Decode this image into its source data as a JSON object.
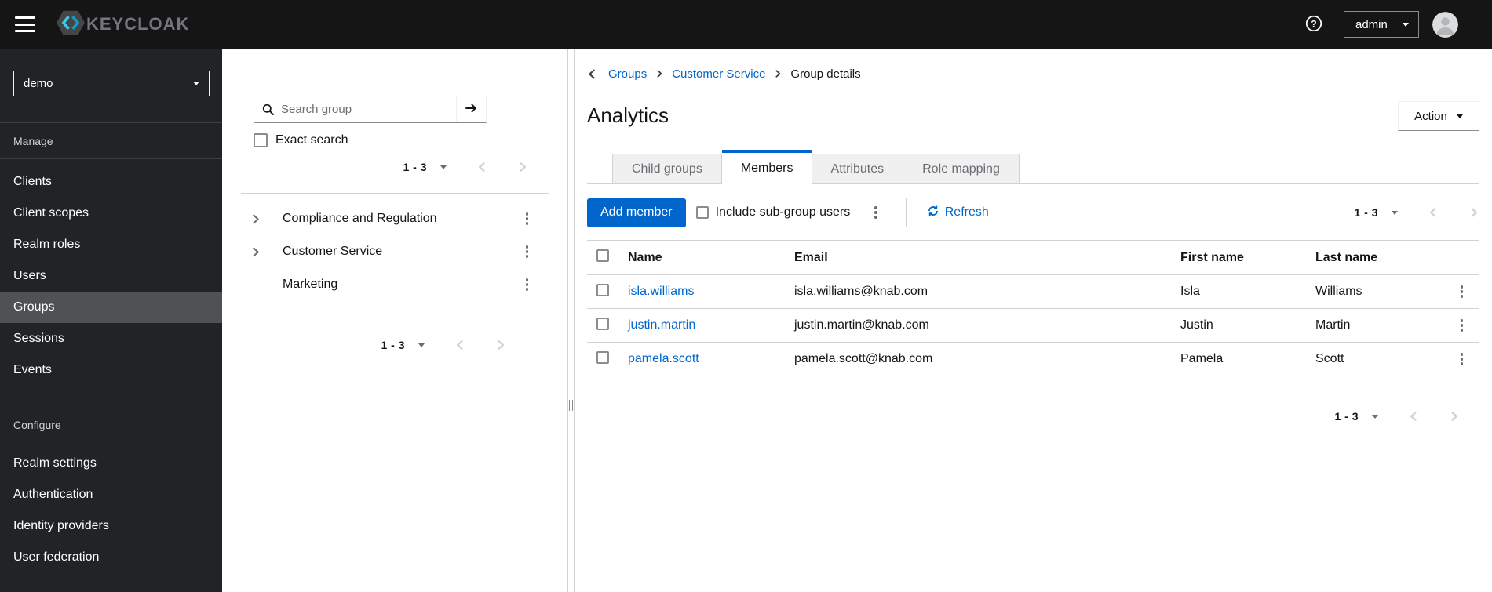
{
  "masthead": {
    "brand": "KEYCLOAK",
    "user": "admin"
  },
  "sidebar": {
    "realm": "demo",
    "sections": [
      {
        "label": "Manage",
        "items": [
          {
            "label": "Clients",
            "active": false
          },
          {
            "label": "Client scopes",
            "active": false
          },
          {
            "label": "Realm roles",
            "active": false
          },
          {
            "label": "Users",
            "active": false
          },
          {
            "label": "Groups",
            "active": true
          },
          {
            "label": "Sessions",
            "active": false
          },
          {
            "label": "Events",
            "active": false
          }
        ]
      },
      {
        "label": "Configure",
        "items": [
          {
            "label": "Realm settings",
            "active": false
          },
          {
            "label": "Authentication",
            "active": false
          },
          {
            "label": "Identity providers",
            "active": false
          },
          {
            "label": "User federation",
            "active": false
          }
        ]
      }
    ]
  },
  "group_tree": {
    "search_placeholder": "Search group",
    "exact_search_label": "Exact search",
    "pagination_top": {
      "range": "1 - 3"
    },
    "pagination_bottom": {
      "range": "1 - 3"
    },
    "items": [
      {
        "label": "Compliance and Regulation",
        "expandable": true
      },
      {
        "label": "Customer Service",
        "expandable": true
      },
      {
        "label": "Marketing",
        "expandable": false
      }
    ]
  },
  "main": {
    "breadcrumb": [
      {
        "label": "Groups",
        "link": true
      },
      {
        "label": "Customer Service",
        "link": true
      },
      {
        "label": "Group details",
        "link": false
      }
    ],
    "title": "Analytics",
    "action_button_label": "Action",
    "tabs": [
      {
        "label": "Child groups",
        "active": false
      },
      {
        "label": "Members",
        "active": true
      },
      {
        "label": "Attributes",
        "active": false
      },
      {
        "label": "Role mapping",
        "active": false
      }
    ],
    "toolbar": {
      "add_member_label": "Add member",
      "include_subgroups_label": "Include sub-group users",
      "refresh_label": "Refresh",
      "pagination_top": {
        "range": "1 - 3"
      },
      "pagination_bottom": {
        "range": "1 - 3"
      }
    },
    "table": {
      "headers": [
        "Name",
        "Email",
        "First name",
        "Last name"
      ],
      "rows": [
        {
          "name": "isla.williams",
          "email": "isla.williams@knab.com",
          "first_name": "Isla",
          "last_name": "Williams"
        },
        {
          "name": "justin.martin",
          "email": "justin.martin@knab.com",
          "first_name": "Justin",
          "last_name": "Martin"
        },
        {
          "name": "pamela.scott",
          "email": "pamela.scott@knab.com",
          "first_name": "Pamela",
          "last_name": "Scott"
        }
      ]
    }
  },
  "icons": {
    "hamburger": "bars",
    "help": "question-circle",
    "caret_down": "▾",
    "search": "magnifier",
    "search_submit": "→",
    "chevron_right": "›",
    "chevron_left": "‹",
    "kebab": "⋮",
    "refresh": "sync",
    "grip": "‖"
  },
  "colors": {
    "primary": "#0066cc",
    "link": "#0066cc",
    "masthead_bg": "#151515",
    "sidebar_bg": "#212427",
    "sidebar_active_bg": "#4f5255",
    "tab_inactive_bg": "#f0f0f0",
    "border": "#d2d2d2",
    "muted_text": "#6a6e73"
  }
}
